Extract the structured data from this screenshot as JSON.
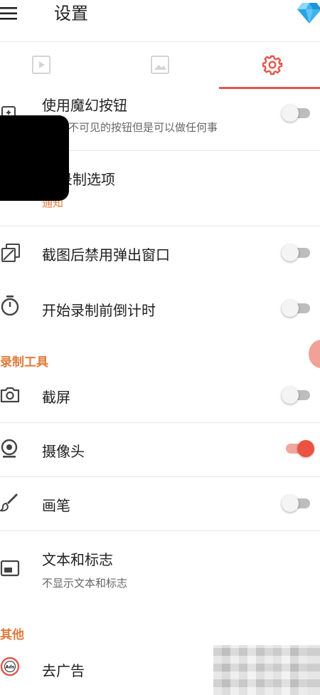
{
  "header": {
    "title": "设置",
    "menu_icon": "hamburger-menu-icon",
    "premium_icon": "diamond-gem-icon"
  },
  "tabs": [
    {
      "icon": "video-file-icon",
      "active": false
    },
    {
      "icon": "image-file-icon",
      "active": false
    },
    {
      "icon": "gear-icon",
      "active": true
    }
  ],
  "colors": {
    "accent": "#e2574c",
    "section": "#e07a3c",
    "toggle_on": "#ec5241"
  },
  "rows": {
    "magic_button": {
      "label": "使用魔幻按钮",
      "sub": "不可见的按钮但是可以做任何事",
      "toggle": false
    },
    "record_options": {
      "label": "录制选项",
      "sub": "通知"
    },
    "disable_popup": {
      "label": "截图后禁用弹出窗口",
      "toggle": false
    },
    "countdown": {
      "label": "开始录制前倒计时",
      "toggle": false
    },
    "screenshot": {
      "label": "截屏",
      "toggle": false
    },
    "camera": {
      "label": "摄像头",
      "toggle": true
    },
    "brush": {
      "label": "画笔",
      "toggle": false
    },
    "text_logo": {
      "label": "文本和标志",
      "sub": "不显示文本和标志"
    },
    "remove_ads": {
      "label": "去广告"
    }
  },
  "sections": {
    "tools": "录制工具",
    "other": "其他"
  }
}
